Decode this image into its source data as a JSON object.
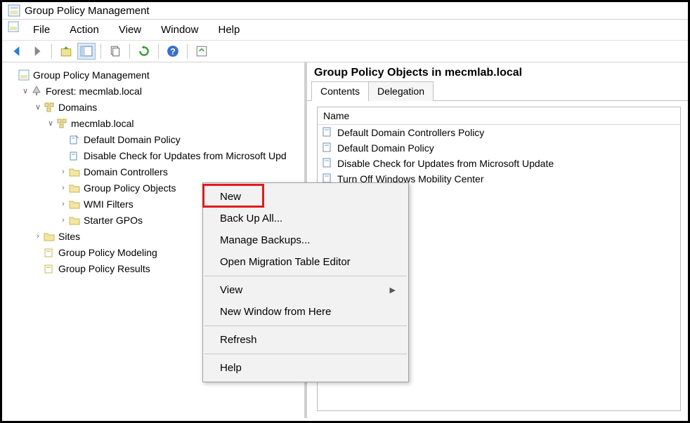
{
  "title": "Group Policy Management",
  "menubar": [
    "File",
    "Action",
    "View",
    "Window",
    "Help"
  ],
  "tree": {
    "root": "Group Policy Management",
    "forest": "Forest: mecmlab.local",
    "domains": "Domains",
    "domain": "mecmlab.local",
    "items": {
      "ddp": "Default Domain Policy",
      "disable": "Disable Check for Updates from Microsoft Upd",
      "dc": "Domain Controllers",
      "gpo": "Group Policy Objects",
      "wmi": "WMI Filters",
      "sgpo": "Starter GPOs"
    },
    "sites": "Sites",
    "modeling": "Group Policy Modeling",
    "results": "Group Policy Results"
  },
  "detail": {
    "heading": "Group Policy Objects in mecmlab.local",
    "tabs": {
      "contents": "Contents",
      "delegation": "Delegation"
    },
    "col": "Name",
    "rows": [
      "Default Domain Controllers Policy",
      "Default Domain Policy",
      "Disable Check for Updates from Microsoft Update",
      "Turn Off Windows Mobility Center"
    ]
  },
  "context": {
    "new": "New",
    "backup": "Back Up All...",
    "manage": "Manage Backups...",
    "migration": "Open Migration Table Editor",
    "view": "View",
    "newwindow": "New Window from Here",
    "refresh": "Refresh",
    "help": "Help"
  }
}
